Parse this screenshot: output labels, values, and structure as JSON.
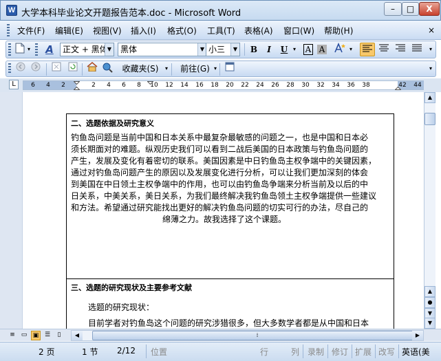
{
  "window": {
    "title": "大学本科毕业论文开题报告范本.doc - Microsoft Word",
    "app_icon": "W",
    "minimize": "–",
    "maximize": "□",
    "close": "X"
  },
  "menu": {
    "items": [
      "文件(F)",
      "编辑(E)",
      "视图(V)",
      "插入(I)",
      "格式(O)",
      "工具(T)",
      "表格(A)",
      "窗口(W)",
      "帮助(H)"
    ],
    "close": "×"
  },
  "format_toolbar": {
    "style_value": "正文 + 黑体",
    "font_value": "黑体",
    "size_value": "小三",
    "bold": "B",
    "italic": "I",
    "underline": "U",
    "char_border": "A",
    "char_shading": "A",
    "style_glyph": "A"
  },
  "web_toolbar": {
    "favorites": "收藏夹(S)",
    "go": "前往(G)"
  },
  "ruler": {
    "corner": "L",
    "ticks": [
      "6",
      "4",
      "2",
      "2",
      "4",
      "6",
      "8",
      "10",
      "12",
      "14",
      "16",
      "18",
      "20",
      "22",
      "24",
      "26",
      "28",
      "30",
      "32",
      "34",
      "36",
      "38",
      "42",
      "44"
    ]
  },
  "document": {
    "heading1": "二、选题依据及研究意义",
    "para1": [
      "钓鱼岛问题是当前中国和日本关系中最复杂最敏感的问题之一，也是中国和日本必",
      "须长期面对的难题。纵观历史我们可以看到二战后美国的日本政策与钓鱼岛问题的",
      "产生，发展及变化有着密切的联系。美国因素是中日钓鱼岛主权争端中的关键因素，",
      "通过对钓鱼岛问题产生的原因以及发展变化进行分析，可以让我们更加深刻的体会",
      "到美国在中日领土主权争端中的作用，也可以由钓鱼岛争端来分析当前及以后的中",
      "日关系，中美关系，美日关系，为我们最终解决我钓鱼岛领土主权争端提供一些建议",
      "和方法。希望通过研究能找出更好的解决钓鱼岛问题的切实可行的办法，尽自己的",
      "绵薄之力。故我选择了这个课题。"
    ],
    "heading2": "三、选题的研究现状及主要参考文献",
    "para2_1": "选题的研究现状：",
    "para2_2": "目前学者对钓鱼岛这个问题的研究涉猎很多，但大多数学者都是从中国和日本"
  },
  "status": {
    "page": "2 页",
    "section": "1 节",
    "pages": "2/12",
    "position": "位置",
    "line": "行",
    "column": "列",
    "rec": "录制",
    "trk": "修订",
    "ext": "扩展",
    "ovr": "改写",
    "lang": "英语(美"
  }
}
